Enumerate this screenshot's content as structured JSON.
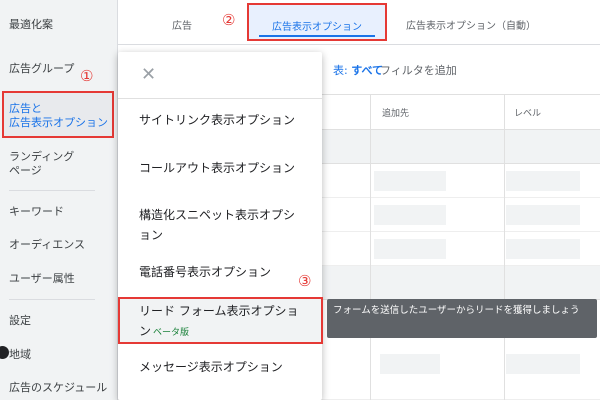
{
  "sidebar": {
    "items": [
      {
        "label": "最適化案"
      },
      {
        "label": "広告グループ"
      },
      {
        "label": "広告と\n広告表示オプション"
      },
      {
        "label": "ランディング\nページ"
      },
      {
        "label": "キーワード"
      },
      {
        "label": "オーディエンス"
      },
      {
        "label": "ユーザー属性"
      },
      {
        "label": "設定"
      },
      {
        "label": "地域"
      },
      {
        "label": "広告のスケジュール"
      }
    ]
  },
  "tabs": [
    {
      "label": "広告"
    },
    {
      "label": "広告表示オプション"
    },
    {
      "label": "広告表示オプション（自動）"
    }
  ],
  "filter": {
    "prefix": "表:",
    "all": "すべて",
    "add": "フィルタを追加"
  },
  "table": {
    "headers": [
      "追加先",
      "レベル"
    ]
  },
  "dropdown": {
    "close_glyph": "✕",
    "items": [
      {
        "label": "サイトリンク表示オプション"
      },
      {
        "label": "コールアウト表示オプション"
      },
      {
        "label": "構造化スニペット表示オプション"
      },
      {
        "label": "電話番号表示オプション"
      },
      {
        "label": "リード フォーム表示オプション",
        "badge": "ベータ版"
      },
      {
        "label": "メッセージ表示オプション"
      }
    ]
  },
  "tooltip": {
    "text": "フォームを送信したユーザーからリードを獲得しましょう"
  },
  "annotations": {
    "one": "①",
    "two": "②",
    "three": "③"
  },
  "colors": {
    "annotation_red": "#e53935",
    "accent_blue": "#1a73e8",
    "beta_green": "#188038"
  }
}
